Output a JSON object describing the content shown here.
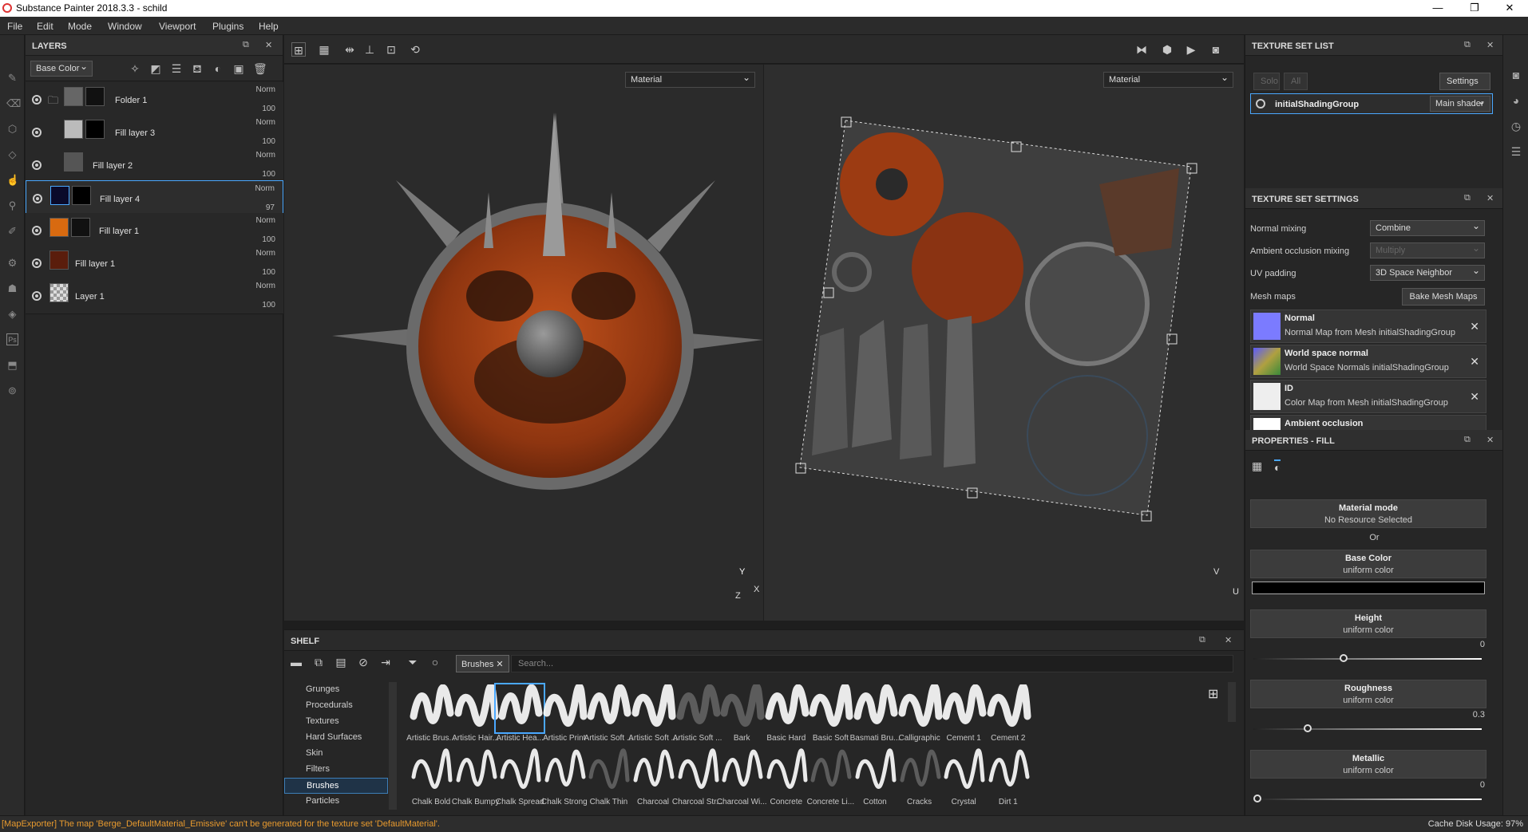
{
  "window": {
    "title": "Substance Painter 2018.3.3 - schild",
    "min": "—",
    "max": "❐",
    "close": "✕"
  },
  "menu": [
    "File",
    "Edit",
    "Mode",
    "Window",
    "Viewport",
    "Plugins",
    "Help"
  ],
  "layers": {
    "title": "LAYERS",
    "channel": "Base Color",
    "items": [
      {
        "name": "Folder 1",
        "blend": "Norm",
        "opacity": "100"
      },
      {
        "name": "Fill layer 3",
        "blend": "Norm",
        "opacity": "100"
      },
      {
        "name": "Fill layer 2",
        "blend": "Norm",
        "opacity": "100"
      },
      {
        "name": "Fill layer 4",
        "blend": "Norm",
        "opacity": "97"
      },
      {
        "name": "Fill layer 1",
        "blend": "Norm",
        "opacity": "100"
      },
      {
        "name": "Fill layer 1",
        "blend": "Norm",
        "opacity": "100"
      },
      {
        "name": "Layer 1",
        "blend": "Norm",
        "opacity": "100"
      }
    ]
  },
  "viewport": {
    "left_mode": "Material",
    "right_mode": "Material",
    "axis3d": {
      "y": "Y",
      "x": "X",
      "z": "Z"
    },
    "axis2d": {
      "v": "V",
      "u": "U"
    }
  },
  "shelf": {
    "title": "SHELF",
    "filter_chip": "Brushes",
    "search_placeholder": "Search...",
    "categories": [
      "Grunges",
      "Procedurals",
      "Textures",
      "Hard Surfaces",
      "Skin",
      "Filters",
      "Brushes",
      "Particles"
    ],
    "active_category": "Brushes",
    "brushes_row1": [
      "Artistic Brus...",
      "Artistic Hair...",
      "Artistic Hea...",
      "Artistic Print",
      "Artistic Soft ...",
      "Artistic Soft ...",
      "Artistic Soft ...",
      "Bark",
      "Basic Hard",
      "Basic Soft",
      "Basmati Bru...",
      "Calligraphic",
      "Cement 1",
      "Cement 2"
    ],
    "brushes_row2": [
      "Chalk Bold",
      "Chalk Bumpy",
      "Chalk Spread",
      "Chalk Strong",
      "Chalk Thin",
      "Charcoal",
      "Charcoal Str...",
      "Charcoal Wi...",
      "Concrete",
      "Concrete Li...",
      "Cotton",
      "Cracks",
      "Crystal",
      "Dirt 1"
    ]
  },
  "texture_set_list": {
    "title": "TEXTURE SET LIST",
    "solo": "Solo",
    "all": "All",
    "settings": "Settings",
    "set_name": "initialShadingGroup",
    "shader": "Main shader"
  },
  "texture_set_settings": {
    "title": "TEXTURE SET SETTINGS",
    "normal_mixing_label": "Normal mixing",
    "normal_mixing": "Combine",
    "ao_label": "Ambient occlusion mixing",
    "ao": "Multiply",
    "uv_label": "UV padding",
    "uv": "3D Space Neighbor",
    "mesh_maps_label": "Mesh maps",
    "bake_button": "Bake Mesh Maps",
    "maps": [
      {
        "name": "Normal",
        "desc": "Normal Map from Mesh initialShadingGroup",
        "color": "#7b7bff"
      },
      {
        "name": "World space normal",
        "desc": "World Space Normals initialShadingGroup",
        "color": "#8f7f5a"
      },
      {
        "name": "ID",
        "desc": "Color Map from Mesh initialShadingGroup",
        "color": "#ffffff"
      },
      {
        "name": "Ambient occlusion",
        "desc": "",
        "color": "#ffffff"
      }
    ]
  },
  "properties": {
    "title": "PROPERTIES - FILL",
    "tabs": [
      "color",
      "height",
      "rough",
      "metal",
      "nrm"
    ],
    "material_mode": "Material mode",
    "no_resource": "No Resource Selected",
    "or": "Or",
    "groups": [
      {
        "name": "Base Color",
        "sub": "uniform color"
      },
      {
        "name": "Height",
        "sub": "uniform color",
        "value": "0",
        "level": 0.39
      },
      {
        "name": "Roughness",
        "sub": "uniform color",
        "value": "0.3",
        "level": 0.23
      },
      {
        "name": "Metallic",
        "sub": "uniform color",
        "value": "0",
        "level": 0.0
      }
    ]
  },
  "status": {
    "message": "[MapExporter] The map 'Berge_DefaultMaterial_Emissive' can't be generated for the texture set 'DefaultMaterial'.",
    "cache": "Cache Disk Usage:   97%"
  }
}
